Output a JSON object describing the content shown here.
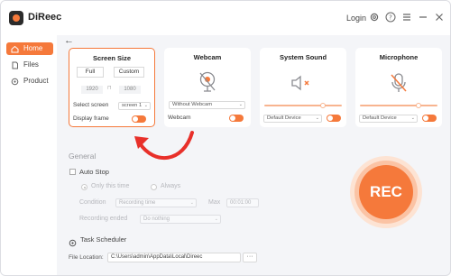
{
  "app": {
    "name": "DiReec",
    "login_label": "Login"
  },
  "colors": {
    "accent": "#f5793b",
    "accent_light": "#f8b48f",
    "annotation_red": "#e8302a"
  },
  "titlebar_icons": [
    "gear-icon",
    "help-icon",
    "menu-icon",
    "minimize-icon",
    "close-icon"
  ],
  "sidebar": {
    "items": [
      {
        "label": "Home",
        "icon": "home-icon",
        "active": true
      },
      {
        "label": "Files",
        "icon": "file-icon",
        "active": false
      },
      {
        "label": "Product",
        "icon": "product-icon",
        "active": false
      }
    ]
  },
  "screen_size": {
    "title": "Screen Size",
    "full_label": "Full",
    "custom_label": "Custom",
    "width": "1920",
    "height": "1080",
    "select_screen_label": "Select screen",
    "select_screen_value": "screen 1",
    "display_frame_label": "Display frame",
    "display_frame_on": true
  },
  "webcam": {
    "title": "Webcam",
    "select_value": "Without Webcam",
    "toggle_label": "Webcam",
    "toggle_on": true
  },
  "system_sound": {
    "title": "System Sound",
    "device_value": "Default Device",
    "volume_percent": 75,
    "muted": true
  },
  "microphone": {
    "title": "Microphone",
    "device_value": "Default Device",
    "volume_percent": 75,
    "muted": true
  },
  "general": {
    "section_label": "General",
    "auto_stop_label": "Auto Stop",
    "only_this_time_label": "Only this time",
    "always_label": "Always",
    "condition_label": "Condition",
    "condition_value": "Recording time",
    "max_label": "Max",
    "max_value": "00:01:00",
    "recording_ended_label": "Recording ended",
    "recording_ended_value": "Do nothing",
    "task_scheduler_label": "Task Scheduler",
    "file_location_label": "File Location:",
    "file_location_value": "C:\\Users\\admin\\AppData\\Local\\Direec",
    "browse_label": "···"
  },
  "rec_button_label": "REC"
}
